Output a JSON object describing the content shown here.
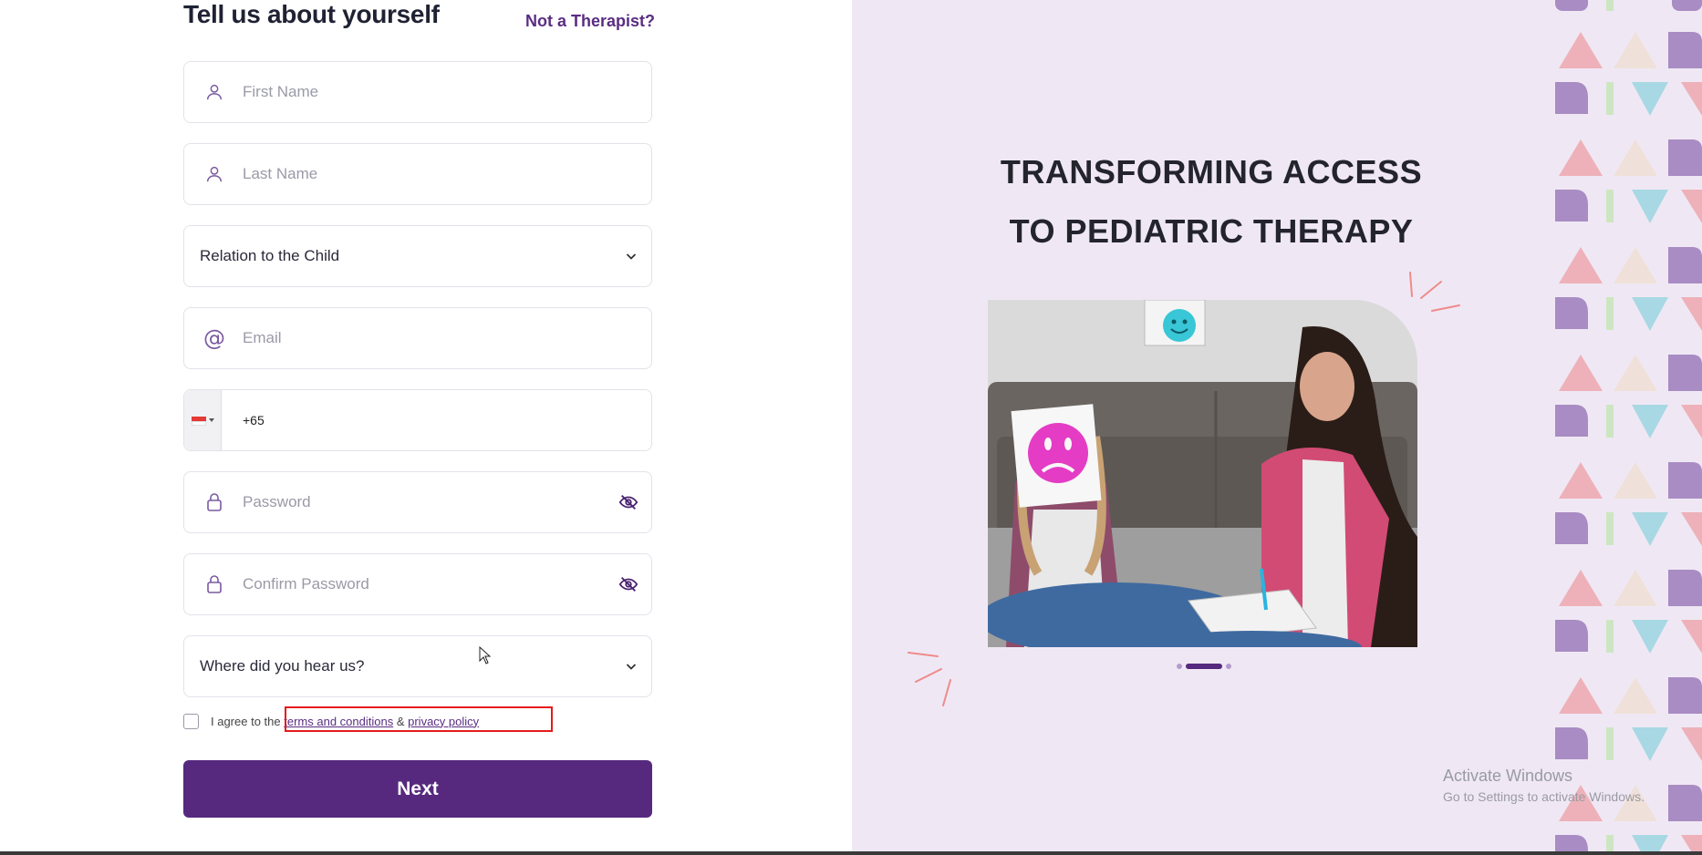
{
  "form": {
    "title": "Tell us about yourself",
    "not_therapist_link": "Not a Therapist?",
    "first_name_placeholder": "First Name",
    "last_name_placeholder": "Last Name",
    "relation_select": "Relation to the Child",
    "email_placeholder": "Email",
    "phone_code": "+65",
    "password_placeholder": "Password",
    "confirm_password_placeholder": "Confirm Password",
    "source_select": "Where did you hear us?",
    "agree_prefix": "I agree to the",
    "terms_link": "terms and conditions",
    "ampersand": "&",
    "privacy_link": "privacy policy",
    "next_button": "Next"
  },
  "hero": {
    "headline_line1": "TRANSFORMING ACCESS",
    "headline_line2": "TO PEDIATRIC THERAPY",
    "carousel_slides": 3,
    "carousel_active_index": 1
  },
  "windows_watermark": {
    "line1": "Activate Windows",
    "line2": "Go to Settings to activate Windows."
  },
  "colors": {
    "brand_purple": "#56297e",
    "panel_bg": "#efe8f4",
    "highlight_red": "#e41b1b"
  }
}
